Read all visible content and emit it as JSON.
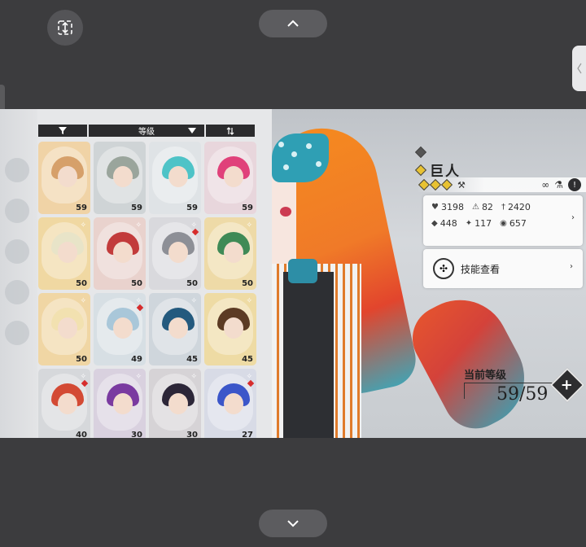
{
  "system": {
    "top_button": "^",
    "bottom_button": "v"
  },
  "sort_bar": {
    "sort_label": "等级"
  },
  "roster": [
    {
      "level": "59",
      "bg": "#f0d3a6",
      "hair": "#d6a06a"
    },
    {
      "level": "59",
      "bg": "#cfd4d6",
      "hair": "#9aa59c"
    },
    {
      "level": "59",
      "bg": "#dfe3e6",
      "hair": "#4ec3c7"
    },
    {
      "level": "59",
      "bg": "#e8d6dc",
      "hair": "#e0417a"
    },
    {
      "level": "50",
      "bg": "#f0d8a2",
      "hair": "#e8e4c8"
    },
    {
      "level": "50",
      "bg": "#e9d2cd",
      "hair": "#c23b3b"
    },
    {
      "level": "50",
      "bg": "#d9d9dd",
      "hair": "#8d8f96"
    },
    {
      "level": "50",
      "bg": "#eedaa7",
      "hair": "#3f8a56"
    },
    {
      "level": "50",
      "bg": "#f0d6a4",
      "hair": "#f2e1b0"
    },
    {
      "level": "49",
      "bg": "#d7dfe4",
      "hair": "#a9c7d9"
    },
    {
      "level": "45",
      "bg": "#cfd6dc",
      "hair": "#245a7e"
    },
    {
      "level": "45",
      "bg": "#eedba4",
      "hair": "#5c3b24"
    },
    {
      "level": "40",
      "bg": "#d6d8db",
      "hair": "#d34a34"
    },
    {
      "level": "30",
      "bg": "#d9d1df",
      "hair": "#7a3aa0"
    },
    {
      "level": "30",
      "bg": "#d6d3d6",
      "hair": "#2c2638"
    },
    {
      "level": "27",
      "bg": "#d8dbe6",
      "hair": "#3b56c9"
    }
  ],
  "character": {
    "name": "巨人",
    "stats": [
      {
        "icon": "heart-icon",
        "glyph": "♥",
        "value": "3198"
      },
      {
        "icon": "attack-icon",
        "glyph": "⚠",
        "value": "82"
      },
      {
        "icon": "sword-icon",
        "glyph": "†",
        "value": "2420"
      },
      {
        "icon": "shield-icon",
        "glyph": "◆",
        "value": "448"
      },
      {
        "icon": "crit-icon",
        "glyph": "✦",
        "value": "117"
      },
      {
        "icon": "speed-icon",
        "glyph": "◉",
        "value": "657"
      }
    ],
    "skill_label": "技能查看",
    "level_label": "当前等级",
    "level_value": "59/59"
  }
}
